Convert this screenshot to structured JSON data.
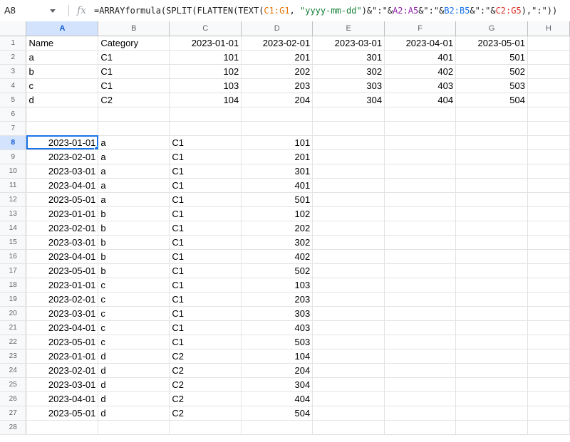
{
  "formula_bar": {
    "cell_ref": "A8",
    "fx": "fx",
    "formula_parts": [
      {
        "t": "=ARRAYformula(SPLIT(FLATTEN(TEXT(",
        "c": ""
      },
      {
        "t": "C1:G1",
        "c": "f-ref1"
      },
      {
        "t": ", ",
        "c": ""
      },
      {
        "t": "\"yyyy-mm-dd\"",
        "c": "f-str"
      },
      {
        "t": ")&\":\"&",
        "c": ""
      },
      {
        "t": "A2:A5",
        "c": "f-ref2"
      },
      {
        "t": "&\":\"&",
        "c": ""
      },
      {
        "t": "B2:B5",
        "c": "f-ref3"
      },
      {
        "t": "&\":\"&",
        "c": ""
      },
      {
        "t": "C2:G5",
        "c": "f-ref4"
      },
      {
        "t": "),\":\"))",
        "c": ""
      }
    ]
  },
  "columns": [
    "A",
    "B",
    "C",
    "D",
    "E",
    "F",
    "G",
    "H"
  ],
  "selected_column": "A",
  "selected_row": "8",
  "active_cell": "A8",
  "rows": [
    {
      "n": "1",
      "cells": [
        "Name",
        "Category",
        "2023-01-01",
        "2023-02-01",
        "2023-03-01",
        "2023-04-01",
        "2023-05-01",
        ""
      ]
    },
    {
      "n": "2",
      "cells": [
        "a",
        "C1",
        "101",
        "201",
        "301",
        "401",
        "501",
        ""
      ]
    },
    {
      "n": "3",
      "cells": [
        "b",
        "C1",
        "102",
        "202",
        "302",
        "402",
        "502",
        ""
      ]
    },
    {
      "n": "4",
      "cells": [
        "c",
        "C1",
        "103",
        "203",
        "303",
        "403",
        "503",
        ""
      ]
    },
    {
      "n": "5",
      "cells": [
        "d",
        "C2",
        "104",
        "204",
        "304",
        "404",
        "504",
        ""
      ]
    },
    {
      "n": "6",
      "cells": [
        "",
        "",
        "",
        "",
        "",
        "",
        "",
        ""
      ]
    },
    {
      "n": "7",
      "cells": [
        "",
        "",
        "",
        "",
        "",
        "",
        "",
        ""
      ]
    },
    {
      "n": "8",
      "cells": [
        "2023-01-01",
        "a",
        "C1",
        "101",
        "",
        "",
        "",
        ""
      ]
    },
    {
      "n": "9",
      "cells": [
        "2023-02-01",
        "a",
        "C1",
        "201",
        "",
        "",
        "",
        ""
      ]
    },
    {
      "n": "10",
      "cells": [
        "2023-03-01",
        "a",
        "C1",
        "301",
        "",
        "",
        "",
        ""
      ]
    },
    {
      "n": "11",
      "cells": [
        "2023-04-01",
        "a",
        "C1",
        "401",
        "",
        "",
        "",
        ""
      ]
    },
    {
      "n": "12",
      "cells": [
        "2023-05-01",
        "a",
        "C1",
        "501",
        "",
        "",
        "",
        ""
      ]
    },
    {
      "n": "13",
      "cells": [
        "2023-01-01",
        "b",
        "C1",
        "102",
        "",
        "",
        "",
        ""
      ]
    },
    {
      "n": "14",
      "cells": [
        "2023-02-01",
        "b",
        "C1",
        "202",
        "",
        "",
        "",
        ""
      ]
    },
    {
      "n": "15",
      "cells": [
        "2023-03-01",
        "b",
        "C1",
        "302",
        "",
        "",
        "",
        ""
      ]
    },
    {
      "n": "16",
      "cells": [
        "2023-04-01",
        "b",
        "C1",
        "402",
        "",
        "",
        "",
        ""
      ]
    },
    {
      "n": "17",
      "cells": [
        "2023-05-01",
        "b",
        "C1",
        "502",
        "",
        "",
        "",
        ""
      ]
    },
    {
      "n": "18",
      "cells": [
        "2023-01-01",
        "c",
        "C1",
        "103",
        "",
        "",
        "",
        ""
      ]
    },
    {
      "n": "19",
      "cells": [
        "2023-02-01",
        "c",
        "C1",
        "203",
        "",
        "",
        "",
        ""
      ]
    },
    {
      "n": "20",
      "cells": [
        "2023-03-01",
        "c",
        "C1",
        "303",
        "",
        "",
        "",
        ""
      ]
    },
    {
      "n": "21",
      "cells": [
        "2023-04-01",
        "c",
        "C1",
        "403",
        "",
        "",
        "",
        ""
      ]
    },
    {
      "n": "22",
      "cells": [
        "2023-05-01",
        "c",
        "C1",
        "503",
        "",
        "",
        "",
        ""
      ]
    },
    {
      "n": "23",
      "cells": [
        "2023-01-01",
        "d",
        "C2",
        "104",
        "",
        "",
        "",
        ""
      ]
    },
    {
      "n": "24",
      "cells": [
        "2023-02-01",
        "d",
        "C2",
        "204",
        "",
        "",
        "",
        ""
      ]
    },
    {
      "n": "25",
      "cells": [
        "2023-03-01",
        "d",
        "C2",
        "304",
        "",
        "",
        "",
        ""
      ]
    },
    {
      "n": "26",
      "cells": [
        "2023-04-01",
        "d",
        "C2",
        "404",
        "",
        "",
        "",
        ""
      ]
    },
    {
      "n": "27",
      "cells": [
        "2023-05-01",
        "d",
        "C2",
        "504",
        "",
        "",
        "",
        ""
      ]
    },
    {
      "n": "28",
      "cells": [
        "",
        "",
        "",
        "",
        "",
        "",
        "",
        ""
      ]
    }
  ],
  "colors": {
    "accent": "#1a73e8",
    "header_bg": "#f8f9fa",
    "selected_header_bg": "#d3e3fd"
  }
}
